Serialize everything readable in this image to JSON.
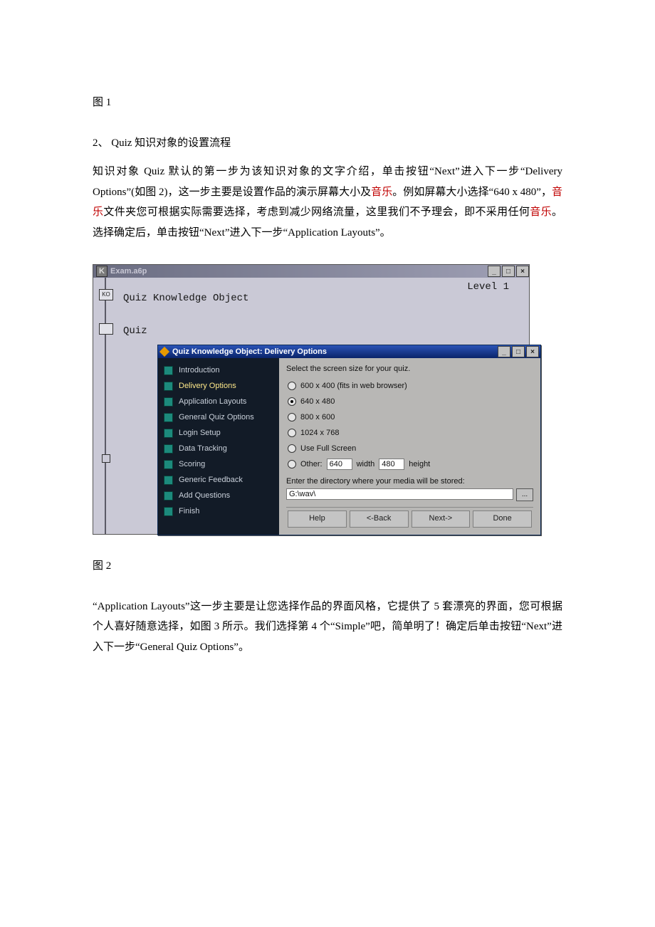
{
  "captions": {
    "fig1": "图 1",
    "fig2": "图 2"
  },
  "heading2": "2、 Quiz 知识对象的设置流程",
  "para1": {
    "s1": "知识对象 Quiz 默认的第一步为该知识对象的文字介绍，单击按钮“Next”进入下一步“Delivery Options”(如图 2)，这一步主要是设置作品的演示屏幕大小及",
    "r1": "音乐",
    "s2": "。例如屏幕大小选择“640 x 480”，",
    "r2": "音乐",
    "s3": "文件夹您可根据实际需要选择，考虑到减少网络流量，这里我们不予理会，即不采用任何",
    "r3": "音乐",
    "s4": "。选择确定后，单击按钮“Next”进入下一步“Application Layouts”。"
  },
  "para2": "“Application Layouts”这一步主要是让您选择作品的界面风格，它提供了 5 套漂亮的界面，您可根据个人喜好随意选择，如图 3 所示。我们选择第 4 个“Simple”吧，简单明了！确定后单击按钮“Next”进入下一步“General Quiz Options”。",
  "outerWindow": {
    "icon_label": "K",
    "title": "Exam.a6p",
    "level_label": "Level 1",
    "flow_ko_label": "Quiz Knowledge Object",
    "flow_quiz_label": "Quiz",
    "rail_ko_text": "KO"
  },
  "dialog": {
    "title": "Quiz Knowledge Object: Delivery Options",
    "nav_items": [
      {
        "label": "Introduction",
        "active": false
      },
      {
        "label": "Delivery Options",
        "active": true
      },
      {
        "label": "Application Layouts",
        "active": false
      },
      {
        "label": "General Quiz Options",
        "active": false
      },
      {
        "label": "Login Setup",
        "active": false
      },
      {
        "label": "Data Tracking",
        "active": false
      },
      {
        "label": "Scoring",
        "active": false
      },
      {
        "label": "Generic Feedback",
        "active": false
      },
      {
        "label": "Add Questions",
        "active": false
      },
      {
        "label": "Finish",
        "active": false
      }
    ],
    "prompt1": "Select the screen size for your quiz.",
    "radios": {
      "r1": "600 x 400 (fits in web browser)",
      "r2": "640 x 480",
      "r3": "800 x 600",
      "r4": "1024 x 768",
      "r5": "Use Full Screen",
      "r6": "Other:"
    },
    "other_w_value": "640",
    "other_w_label": "width",
    "other_h_value": "480",
    "other_h_label": "height",
    "prompt2": "Enter the directory where your media will be stored:",
    "dir_value": "G:\\wav\\",
    "browse_label": "...",
    "buttons": {
      "help": "Help",
      "back": "<-Back",
      "next": "Next->",
      "done": "Done"
    }
  }
}
